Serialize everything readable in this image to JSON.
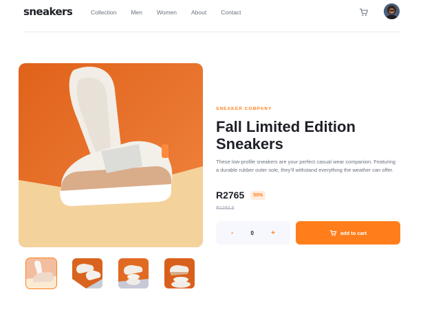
{
  "header": {
    "logo": "sneakers",
    "nav": [
      "Collection",
      "Men",
      "Women",
      "About",
      "Contact"
    ],
    "cart_icon": "cart-icon",
    "avatar_icon": "avatar"
  },
  "gallery": {
    "main_image": "product-photo",
    "thumbnails": [
      "thumbnail-1",
      "thumbnail-2",
      "thumbnail-3",
      "thumbnail-4"
    ]
  },
  "product": {
    "company": "SNEAKER COMPANY",
    "title": "Fall Limited Edition Sneakers",
    "description": "These low-profile sneakers are your perfect casual wear companion. Featuring a durable rubber outer sole, they’ll withstand everything the weather can offer.",
    "price": "R2765",
    "discount": "50%",
    "original_price": "R1382.5"
  },
  "cart": {
    "minus": "-",
    "quantity": "0",
    "plus": "+",
    "add_label": "add to cart"
  },
  "colors": {
    "accent": "#ff7e1b",
    "badge_bg": "#ffede0",
    "text_dark": "#1d2026",
    "text_muted": "#69707d"
  }
}
